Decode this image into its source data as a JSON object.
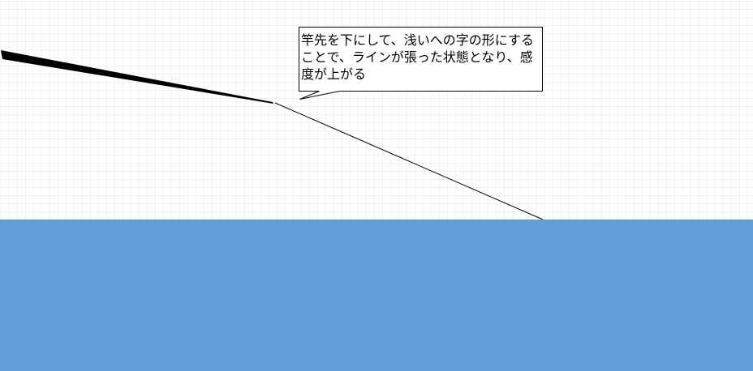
{
  "canvas": {
    "grid_color": "#e6e6e6",
    "background": "#ffffff"
  },
  "water": {
    "color": "#639ddc"
  },
  "rod": {
    "color": "#000000"
  },
  "line": {
    "color": "#000000"
  },
  "callout": {
    "text": "竿先を下にして、浅いへの字の形にすることで、ラインが張った状態となり、感度が上がる",
    "border_color": "#000000",
    "fill": "#ffffff"
  }
}
